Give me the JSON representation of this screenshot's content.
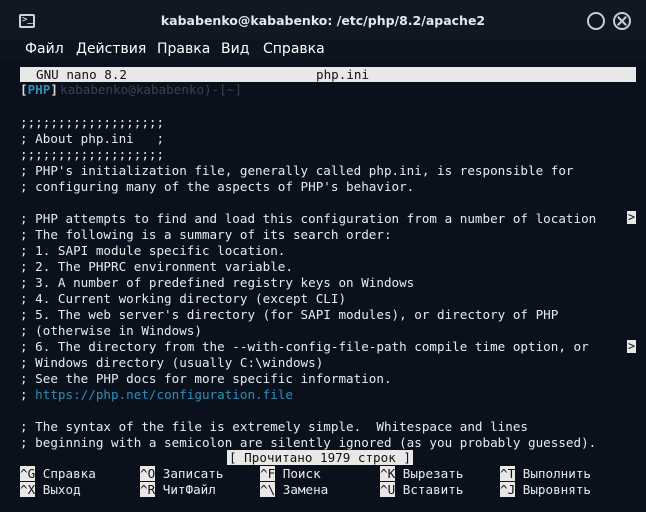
{
  "window": {
    "title": "kababenko@kababenko: /etc/php/8.2/apache2",
    "icon": "terminal-icon"
  },
  "menu": [
    "Файл",
    "Действия",
    "Правка",
    "Вид",
    "Справка"
  ],
  "nano": {
    "version": "GNU nano 8.2",
    "filename": "php.ini",
    "syntax_label": "PHP",
    "syntax_open": "[",
    "syntax_close": "]",
    "behind_text": "kababenko@kababenko)-[~]"
  },
  "lines": [
    ";;;;;;;;;;;;;;;;;;;",
    "; About php.ini   ;",
    ";;;;;;;;;;;;;;;;;;;",
    "; PHP's initialization file, generally called php.ini, is responsible for",
    "; configuring many of the aspects of PHP's behavior.",
    "",
    "; PHP attempts to find and load this configuration from a number of location",
    "; The following is a summary of its search order:",
    "; 1. SAPI module specific location.",
    "; 2. The PHPRC environment variable.",
    "; 3. A number of predefined registry keys on Windows",
    "; 4. Current working directory (except CLI)",
    "; 5. The web server's directory (for SAPI modules), or directory of PHP",
    "; (otherwise in Windows)",
    "; 6. The directory from the --with-config-file-path compile time option, or",
    "; Windows directory (usually C:\\windows)",
    "; See the PHP docs for more specific information.",
    "; ",
    "",
    "; The syntax of the file is extremely simple.  Whitespace and lines",
    "; beginning with a semicolon are silently ignored (as you probably guessed)."
  ],
  "url_line": "https://php.net/configuration.file",
  "more_marker": ">",
  "status": "[ Прочитано 1979 строк ]",
  "shortcuts": [
    {
      "key": "^G",
      "label": "Справка"
    },
    {
      "key": "^O",
      "label": "Записать"
    },
    {
      "key": "^F",
      "label": "Поиск"
    },
    {
      "key": "^K",
      "label": "Вырезать"
    },
    {
      "key": "^T",
      "label": "Выполнить"
    },
    {
      "key": "^X",
      "label": "Выход"
    },
    {
      "key": "^R",
      "label": "ЧитФайл"
    },
    {
      "key": "^\\",
      "label": "Замена"
    },
    {
      "key": "^U",
      "label": "Вставить"
    },
    {
      "key": "^J",
      "label": "Выровнять"
    }
  ],
  "colors": {
    "background": "#0a111c",
    "text": "#e8eaee",
    "highlight_bg": "#e8e8e8",
    "accent": "#2f8fb5"
  }
}
